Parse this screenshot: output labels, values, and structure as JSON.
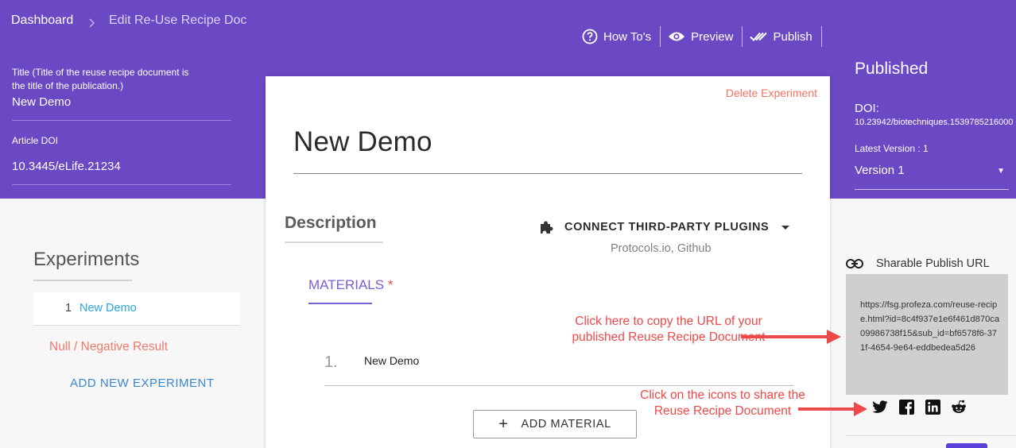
{
  "breadcrumb": {
    "home": "Dashboard",
    "current": "Edit Re-Use Recipe Doc"
  },
  "toolbar": {
    "howto": "How To's",
    "preview": "Preview",
    "publish": "Publish"
  },
  "left_panel": {
    "title_label": "Title (Title of the reuse recipe document is the title of the publication.)",
    "title_value": "New Demo",
    "doi_label": "Article DOI",
    "doi_value": "10.3445/eLife.21234"
  },
  "card": {
    "delete": "Delete Experiment",
    "title": "New Demo",
    "description": "Description",
    "plugins_label": "CONNECT THIRD-PARTY PLUGINS",
    "plugins_sub": "Protocols.io, Github",
    "materials_tab": "MATERIALS",
    "materials_required": "*",
    "material_number": "1.",
    "material_name": "New Demo",
    "add_material": "ADD MATERIAL"
  },
  "experiments": {
    "title": "Experiments",
    "items": [
      {
        "number": "1",
        "name": "New Demo"
      }
    ],
    "null_result": "Null / Negative Result",
    "add": "ADD NEW EXPERIMENT"
  },
  "published": {
    "title": "Published",
    "doi_label": "DOI:",
    "doi_value": "10.23942/biotechniques.1539785216000",
    "latest_version": "Latest Version : 1",
    "version_selected": "Version 1",
    "share_label": "Sharable Publish URL",
    "url": "https://fsg.profeza.com/reuse-recipe.html?id=8c4f937e1e6f461d870ca09986738f15&sub_id=bf6578f6-371f-4654-9e64-eddbedea5d26",
    "share_icons": [
      "twitter-icon",
      "facebook-icon",
      "linkedin-icon",
      "reddit-icon"
    ]
  },
  "annotations": {
    "copy_note": "Click here to copy the URL of your published Reuse Recipe Document",
    "share_note": "Click on the icons to share the Reuse Recipe Document"
  },
  "colors": {
    "header": "#6b48c4",
    "accent": "#7a5fd0",
    "danger": "#ef4848",
    "link": "#2aa6d8"
  }
}
